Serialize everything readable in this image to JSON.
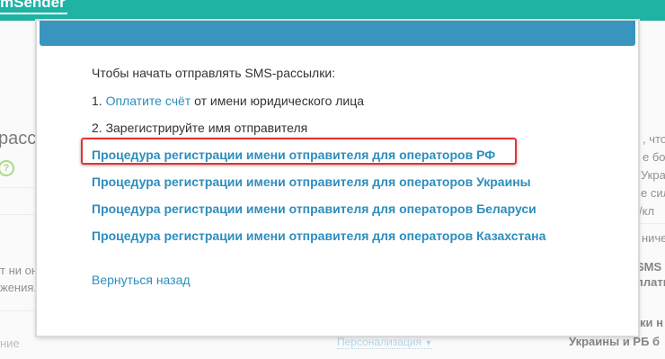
{
  "header": {
    "brand_label": "mSender"
  },
  "background": {
    "left_heading": "рассы",
    "left_qmark": "?",
    "left_text_1": "т ни он",
    "left_text_2": "жения.",
    "left_text_3": "ние",
    "right_text_1": ", что",
    "right_text_2": "е бо",
    "right_text_3": "Украи",
    "right_text_4": "е сил",
    "right_text_5": "/кл",
    "right_text_6": "ничес",
    "right_text_7": "SMS р",
    "right_text_8": "плать",
    "right_text_9": "ки н",
    "right_text_10": "Украины и РБ б",
    "personalization_label": "Персонализация"
  },
  "modal": {
    "intro": "Чтобы начать отправлять SMS-рассылки:",
    "step1_prefix": "1. ",
    "step1_link": "Оплатите счёт",
    "step1_suffix": " от имени юридического лица",
    "step2": "2. Зарегистрируйте имя отправителя",
    "links": [
      "Процедура регистрации имени отправителя для операторов РФ",
      "Процедура регистрации имени отправителя для операторов Украины",
      "Процедура регистрации имени отправителя для операторов Беларуси",
      "Процедура регистрации имени отправителя для операторов Казахстана"
    ],
    "back_link": "Вернуться назад"
  },
  "colors": {
    "topbar": "#1fb3a4",
    "modal_header": "#3a95be",
    "link": "#2d8dbd",
    "highlight_border": "#e8312f"
  }
}
